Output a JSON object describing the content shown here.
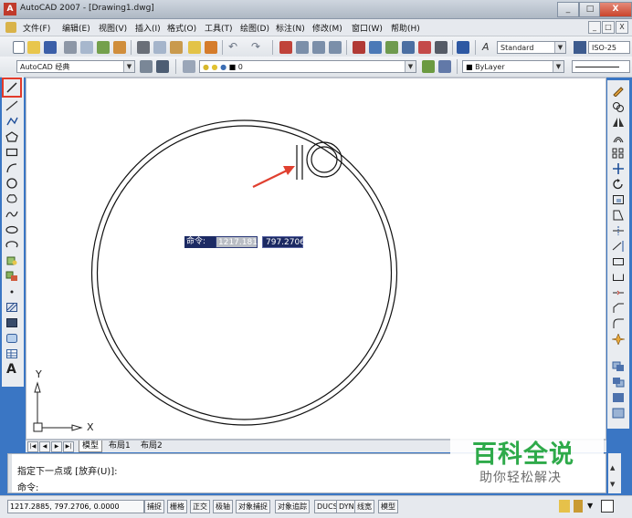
{
  "window": {
    "title": "AutoCAD 2007 - [Drawing1.dwg]",
    "logo": "A",
    "minimize_label": "_",
    "maximize_label": "□",
    "close_label": "X"
  },
  "menubar": {
    "items": [
      "文件(F)",
      "编辑(E)",
      "视图(V)",
      "插入(I)",
      "格式(O)",
      "工具(T)",
      "绘图(D)",
      "标注(N)",
      "修改(M)",
      "窗口(W)",
      "帮助(H)"
    ],
    "doc_controls": [
      "_",
      "□",
      "X"
    ]
  },
  "toolbar1": {
    "text_style": "Standard",
    "dim_style": "ISO-25"
  },
  "toolbar2": {
    "workspace": "AutoCAD 经典",
    "layer": "0",
    "color": "ByLayer"
  },
  "left_toolbar": {
    "tools": [
      "line-icon",
      "construction-line-icon",
      "polyline-icon",
      "polygon-icon",
      "rectangle-icon",
      "arc-icon",
      "circle-icon",
      "revision-cloud-icon",
      "spline-icon",
      "ellipse-icon",
      "ellipse-arc-icon",
      "insert-block-icon",
      "make-block-icon",
      "point-icon",
      "hatch-icon",
      "gradient-icon",
      "region-icon",
      "table-icon",
      "multiline-text-icon"
    ],
    "text_tool_label": "A",
    "highlight_color": "#e23a2a"
  },
  "right_toolbar": {
    "tools": [
      "erase-icon",
      "copy-icon",
      "mirror-icon",
      "offset-icon",
      "array-icon",
      "move-icon",
      "rotate-icon",
      "scale-icon",
      "stretch-icon",
      "trim-icon",
      "extend-icon",
      "break-at-point-icon",
      "break-icon",
      "join-icon",
      "chamfer-icon",
      "fillet-icon",
      "explode-icon",
      "draw-order-icon-1",
      "draw-order-icon-2",
      "draw-order-icon-3",
      "draw-order-icon-4"
    ]
  },
  "canvas": {
    "ucs_x_label": "X",
    "ucs_y_label": "Y",
    "annotation_arrow_color": "#e04030"
  },
  "dynamic_input": {
    "prompt": "命令:",
    "x_value": "1217.1818",
    "y_value": "797.2706"
  },
  "layout_tabs": {
    "nav_buttons": [
      "|◀",
      "◀",
      "▶",
      "▶|"
    ],
    "tabs": [
      "模型",
      "布局1",
      "布局2"
    ]
  },
  "command_line": {
    "history": "指定下一点或 [放弃(U)]:",
    "prompt": "命令:"
  },
  "status_bar": {
    "coordinates": "1217.2885, 797.2706, 0.0000",
    "toggles": [
      "捕捉",
      "栅格",
      "正交",
      "极轴",
      "对象捕捉",
      "对象追踪",
      "DUCS",
      "DYN",
      "线宽",
      "模型"
    ]
  },
  "watermark": {
    "title": "百科全说",
    "subtitle": "助你轻松解决"
  },
  "colors": {
    "title_bar": "#aeb8c4",
    "desktop": "#3a76c4",
    "canvas": "#ffffff",
    "watermark_green": "#2eaa4a"
  }
}
